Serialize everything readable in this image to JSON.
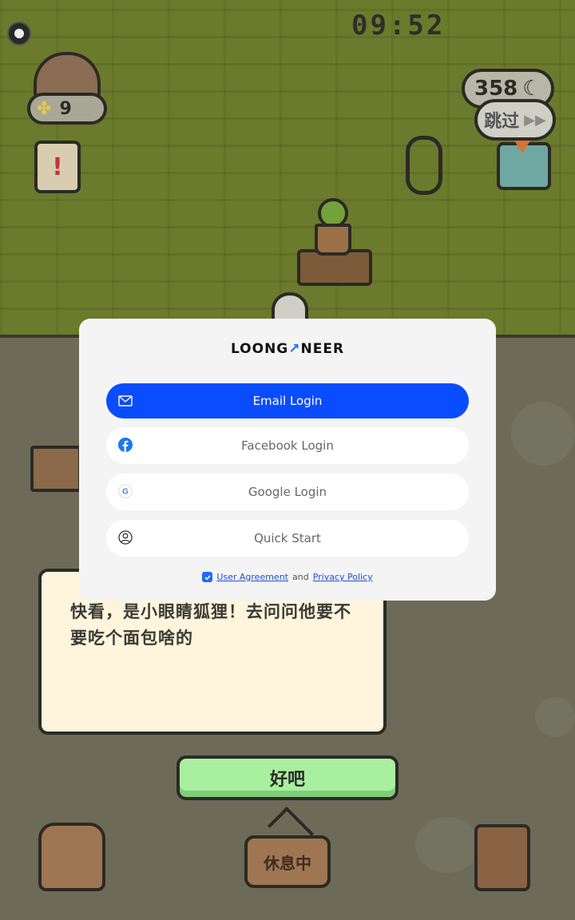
{
  "game": {
    "clock": "09:52",
    "clover_count": "9",
    "moon_count": "358",
    "skip_label": "跳过",
    "dialogue_text": "快看，是小眼睛狐狸！去问问他要不要吃个面包啥的",
    "ok_label": "好吧",
    "rest_sign_label": "休息中"
  },
  "login": {
    "brand_left": "LOONG",
    "brand_right": "NEER",
    "buttons": {
      "email": "Email Login",
      "facebook": "Facebook Login",
      "google": "Google Login",
      "quick": "Quick Start"
    },
    "terms": {
      "agreement": "User Agreement",
      "conjunction": "and",
      "privacy": "Privacy Policy",
      "checked": true
    }
  },
  "colors": {
    "primary_blue": "#0a4cff",
    "facebook_blue": "#1877f2",
    "wall_green": "#6b7a2c",
    "ok_green": "#a8f0a0"
  }
}
